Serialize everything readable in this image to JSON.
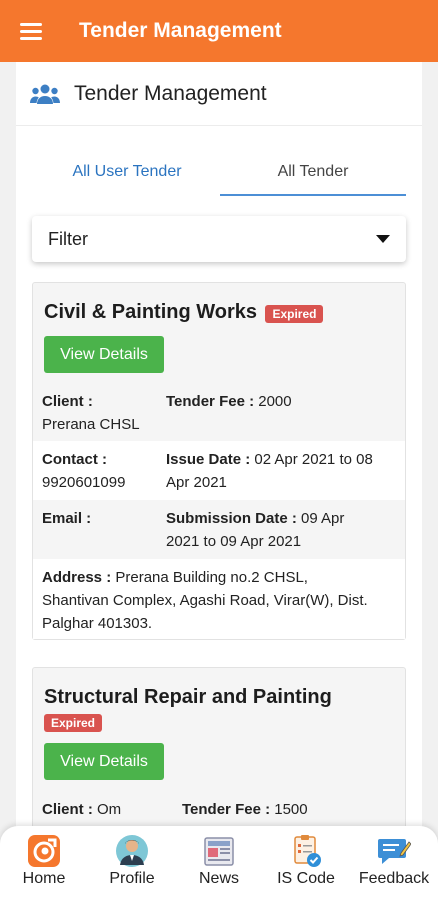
{
  "appbar": {
    "title": "Tender Management"
  },
  "page": {
    "title": "Tender Management"
  },
  "tabs": [
    {
      "label": "All User Tender"
    },
    {
      "label": "All Tender"
    }
  ],
  "filter": {
    "label": "Filter"
  },
  "tenders": [
    {
      "title": "Civil & Painting Works",
      "status": "Expired",
      "button": "View Details",
      "client_label": "Client :",
      "client": "Prerana CHSL",
      "fee_label": "Tender Fee :",
      "fee": "2000",
      "contact_label": "Contact :",
      "contact": "9920601099",
      "issue_label": "Issue Date :",
      "issue_line1": "02 Apr 2021 to 08",
      "issue_line2": "Apr 2021",
      "email_label": "Email :",
      "submission_label": "Submission Date :",
      "submission_line1": "09 Apr",
      "submission_line2": "2021 to 09 Apr 2021",
      "address_label": "Address :",
      "address_line1": "Prerana Building no.2 CHSL,",
      "address_line2": "Shantivan Complex, Agashi Road, Virar(W), Dist.",
      "address_line3": "Palghar 401303."
    },
    {
      "title": "Structural Repair and Painting",
      "status": "Expired",
      "button": "View Details",
      "client_label": "Client :",
      "client": "Om",
      "fee_label": "Tender Fee :",
      "fee": "1500"
    }
  ],
  "nav": [
    {
      "label": "Home",
      "icon": "home-logo-icon"
    },
    {
      "label": "Profile",
      "icon": "profile-person-icon"
    },
    {
      "label": "News",
      "icon": "newspaper-icon"
    },
    {
      "label": "IS Code",
      "icon": "document-check-icon"
    },
    {
      "label": "Feedback",
      "icon": "feedback-chat-icon"
    }
  ],
  "colors": {
    "appbar": "#f5772d",
    "expired": "#d9534f",
    "button": "#4bb34b",
    "tab_active": "#4c8fd6",
    "tab_link": "#2b74c0"
  }
}
